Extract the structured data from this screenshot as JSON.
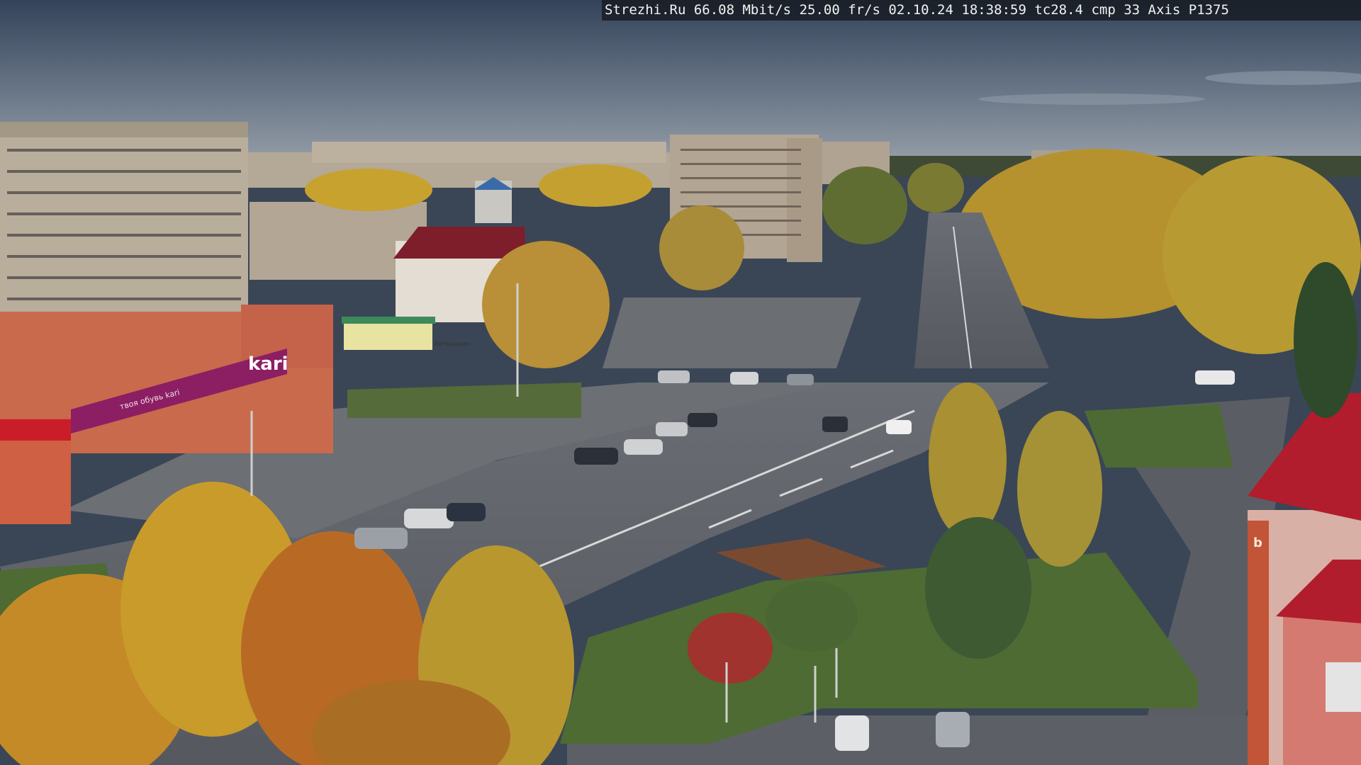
{
  "overlay": {
    "site": "Strezhi.Ru",
    "bitrate": "66.08 Mbit/s",
    "fps": "25.00 fr/s",
    "date": "02.10.24",
    "time": "18:38:59",
    "tc": "tc28.4",
    "cmp": "cmp 33",
    "camera": "Axis P1375"
  },
  "signs": {
    "store": "kari",
    "store_sub": "твоя обувь kari",
    "shop_small": "Авторадио",
    "tower_letter": "b"
  },
  "palette": {
    "sky_top": "#3b4a5f",
    "sky_bottom": "#8a96a3",
    "asphalt": "#5d6168",
    "foliage_yellow": "#c7a22f",
    "foliage_orange": "#b86a25",
    "grass": "#4d6b33",
    "brick": "#c96a4d",
    "panel_block": "#b9ad9c",
    "accent_red": "#a11e2c",
    "accent_magenta": "#8c1e63"
  }
}
